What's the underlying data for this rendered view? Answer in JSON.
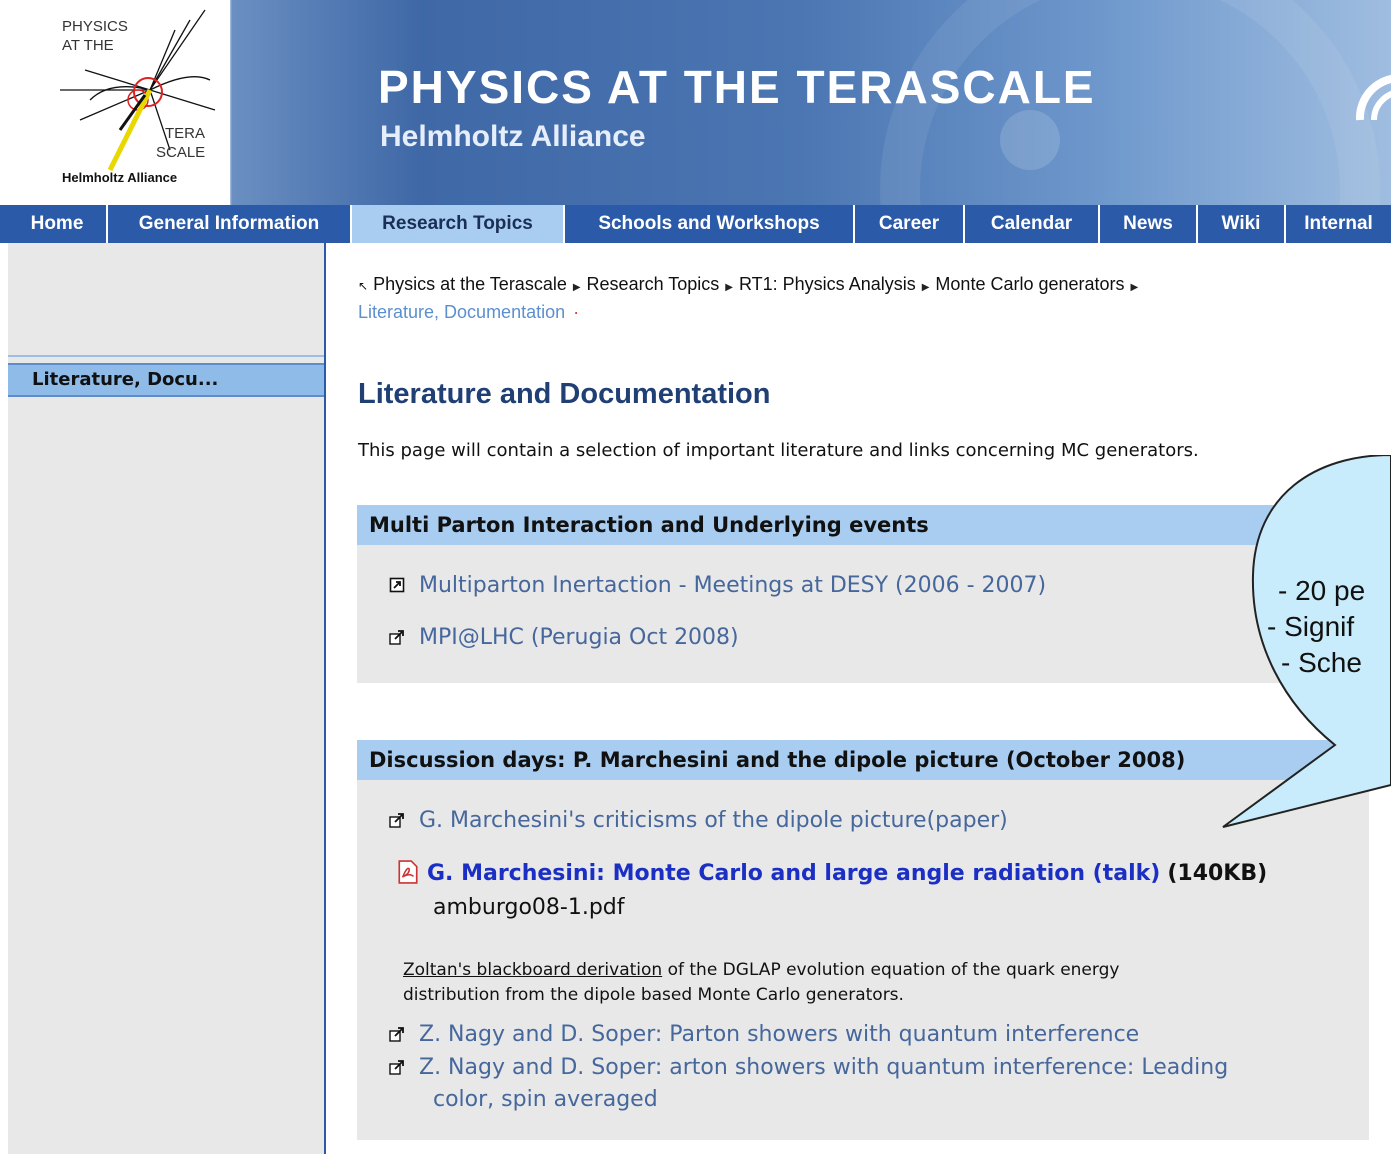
{
  "header": {
    "logo_line1": "PHYSICS",
    "logo_line2": "AT THE",
    "logo_tera": "TERA",
    "logo_scale": "SCALE",
    "logo_alliance": "Helmholtz Alliance",
    "title": "PHYSICS AT THE TERASCALE",
    "subtitle": "Helmholtz Alliance"
  },
  "nav": {
    "items": [
      {
        "label": "Home"
      },
      {
        "label": "General Information"
      },
      {
        "label": "Research Topics",
        "active": true
      },
      {
        "label": "Schools and Workshops"
      },
      {
        "label": "Career"
      },
      {
        "label": "Calendar"
      },
      {
        "label": "News"
      },
      {
        "label": "Wiki"
      },
      {
        "label": "Internal"
      }
    ]
  },
  "sidebar": {
    "active_item": "Literature, Docu..."
  },
  "breadcrumb": {
    "home_arrow": "↖",
    "items": [
      "Physics at the Terascale",
      "Research Topics",
      "RT1: Physics Analysis",
      "Monte Carlo generators"
    ],
    "current": "Literature, Documentation"
  },
  "main": {
    "title": "Literature and Documentation",
    "intro": "This page will contain a selection of important literature and links concerning MC generators.",
    "section1": {
      "heading": "Multi Parton Interaction and Underlying events",
      "links": [
        "Multiparton Inertaction - Meetings at DESY (2006 - 2007)",
        "MPI@LHC (Perugia Oct 2008)"
      ]
    },
    "section2": {
      "heading": "Discussion days: P. Marchesini and the dipole picture (October 2008)",
      "link1": "G. Marchesini's criticisms of the dipole picture(paper)",
      "pdf_link": "G. Marchesini: Monte Carlo and large angle radiation (talk)",
      "pdf_size": "(140KB)",
      "pdf_filename": "amburgo08-1.pdf",
      "para_link": "Zoltan's blackboard derivation",
      "para_text1": " of the DGLAP evolution equation of the quark energy",
      "para_text2": "distribution from the dipole based Monte Carlo generators.",
      "link3": "Z. Nagy and D. Soper: Parton showers with quantum interference",
      "link4_line1": "Z. Nagy and D. Soper: arton showers with quantum interference: Leading",
      "link4_line2": "color, spin averaged"
    }
  },
  "callout": {
    "line1": "- 20 pe",
    "line2": "- Signif",
    "line3": "- Sche"
  },
  "colors": {
    "nav_bg": "#2a5aa8",
    "nav_active": "#a9cdf0",
    "section_head": "#a9cdf0",
    "box_bg": "#e8e8e8",
    "callout_fill": "#c8ecfb"
  }
}
